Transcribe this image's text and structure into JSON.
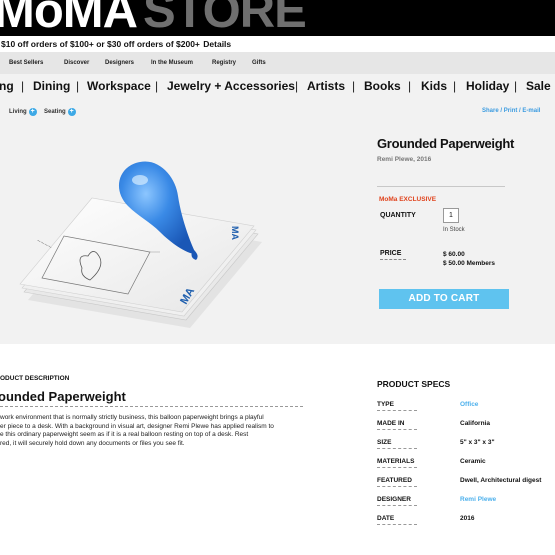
{
  "header": {
    "logo_left": "MoMA",
    "logo_right": "STORE"
  },
  "promo": {
    "text": "$10 off orders of $100+ or $30 off orders of $200+",
    "details": "Details"
  },
  "subnav": [
    "Best Sellers",
    "Discover",
    "Designers",
    "In the Museum",
    "Registry",
    "Gifts"
  ],
  "mainnav": [
    "ng",
    "Dining",
    "Workspace",
    "Jewelry + Accessories",
    "Artists",
    "Books",
    "Kids",
    "Holiday",
    "Sale"
  ],
  "crumbs": [
    "Living",
    "Seating"
  ],
  "share": {
    "share": "Share",
    "print": "Print",
    "email": "E-mail",
    "sep": "/"
  },
  "product": {
    "title": "Grounded Paperweight",
    "artist": "Remi Plewe, 2016",
    "exclusive": "MoMa EXCLUSIVE",
    "quantity_label": "QUANTITY",
    "quantity": "1",
    "stock": "In Stock",
    "price_label": "PRICE",
    "price": "$ 60.00",
    "member_price": "$ 50.00 Members",
    "add_to_cart": "ADD TO CART"
  },
  "description": {
    "label": "ODUCT DESCRIPTION",
    "title": "ounded Paperweight",
    "lines": [
      "work environment that is normally strictly business, this balloon paperweight brings a playful",
      "er piece to a desk. With a background in visual art, designer Remi Plewe has applied realism to",
      "e this ordinary paperweight seem as if it is a real balloon resting on top of a desk. Rest",
      "red, it will securely hold down any documents or files you see fit."
    ]
  },
  "specs": {
    "title": "PRODUCT SPECS",
    "rows": [
      {
        "key": "TYPE",
        "value": "Office",
        "link": true
      },
      {
        "key": "MADE IN",
        "value": "California",
        "link": false
      },
      {
        "key": "SIZE",
        "value": "5\" x 3\" x 3\"",
        "link": false
      },
      {
        "key": "MATERIALS",
        "value": "Ceramic",
        "link": false
      },
      {
        "key": "FEATURED",
        "value": "Dwell, Architectural digest",
        "link": false
      },
      {
        "key": "DESIGNER",
        "value": "Remi Plewe",
        "link": true
      },
      {
        "key": "DATE",
        "value": "2016",
        "link": false
      }
    ]
  },
  "colors": {
    "accent_blue": "#5fc3ef",
    "link_blue": "#4cb0ec",
    "exclusive_red": "#e0431d",
    "balloon": "#2f7fe0"
  }
}
